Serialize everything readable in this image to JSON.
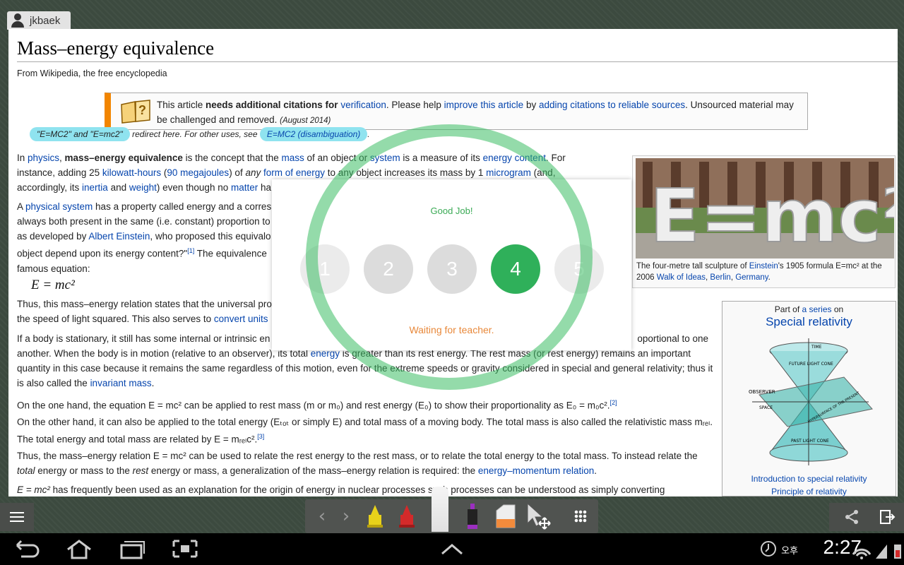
{
  "user": {
    "name": "jkbaek"
  },
  "article": {
    "title": "Mass–energy equivalence",
    "from_line": "From Wikipedia, the free encyclopedia",
    "citation": {
      "t1": "This article ",
      "t2": "needs additional citations for ",
      "t3": "verification",
      "t4": ". Please help ",
      "t5": "improve this article",
      "t6": " by ",
      "t7": "adding citations to reliable sources",
      "t8": ". Unsourced material may be challenged and removed. ",
      "date": "(August 2014)"
    },
    "hatnote": {
      "h1": "\"E=MC2\" and \"E=mc2\"",
      "h2": " redirect here. For other uses, see ",
      "h3": "E=MC2 (disambiguation)",
      "h4": "."
    },
    "p1": {
      "a": "In ",
      "physics": "physics",
      "b": ", ",
      "bold": "mass–energy equivalence",
      "c": " is the concept that the ",
      "mass": "mass",
      "d": " of an object or ",
      "system": "system",
      "e": " is a measure of its ",
      "energy_content": "energy content",
      "f": ". For instance, adding 25 ",
      "kwh": "kilowatt-hours",
      "g": " (",
      "mj": "90 megajoules",
      "h": ") of ",
      "any": "any",
      "i": " ",
      "form": "form of energy",
      "j": " to any object increases its mass by 1 ",
      "microgram": "microgram",
      "k": " (and, accordingly, its ",
      "inertia": "inertia",
      "l": " and ",
      "weight": "weight",
      "m": ") even though no ",
      "matter": "matter",
      "n": " ha"
    },
    "p2": {
      "a": "A ",
      "phys_sys": "physical system",
      "b": " has a property called energy and a corres",
      "c": "always both present in the same (i.e. constant) proportion to",
      "d": "as developed by ",
      "einstein": "Albert Einstein",
      "e": ", who proposed this equivalo",
      "f": "object depend upon its energy content?\"",
      "ref": "[1]",
      "g": " The equivalence",
      "h": "famous equation:"
    },
    "equation": "E = mc²",
    "p3": {
      "a": "Thus, this mass–energy relation states that the universal pro",
      "b": "the speed of light squared. This also serves to ",
      "convert": "convert units"
    },
    "p4": {
      "a": "If a body is stationary, it still has some internal or intrinsic en",
      "a2": "oportional to one another. When the body is in motion (relative to an observer), its total ",
      "energy": "energy",
      "b": " is greater than its rest energy. The rest mass (or rest energy) remains an important quantity in this case because it remains the same regardless of this motion, even for the extreme speeds or gravity considered in special and general relativity; thus it is also called the ",
      "invariant": "invariant mass",
      "c": "."
    },
    "p5": "On the one hand, the equation E = mc² can be applied to rest mass (m or m₀) and rest energy (E₀) to show their proportionality as E₀ = m₀c².",
    "p5_ref": "[2]",
    "p6": "On the other hand, it can also be applied to the total energy (Eₜₒₜ or simply E) and total mass of a moving body. The total mass is also called the relativistic mass mᵣₑₗ. The total energy and total mass are related by E = mᵣₑₗc².",
    "p6_ref": "[3]",
    "p7": {
      "a": "Thus, the mass–energy relation E = mc² can be used to relate the rest energy to the rest mass, or to relate the total energy to the total mass. To instead relate the ",
      "total": "total",
      "b": " energy or mass to the ",
      "rest": "rest",
      "c": " energy or mass, a generalization of the mass–energy relation is required: the ",
      "link": "energy–momentum relation",
      "d": "."
    },
    "p8": {
      "a": "E = mc²",
      "b": " has frequently been used as an explanation for the origin of energy in nuclear processes",
      "c": " such processes can be understood as simply converting"
    },
    "image_caption": {
      "a": "The four-metre tall sculpture of ",
      "einstein": "Einstein",
      "b": "'s 1905 formula E=mc² at the 2006 ",
      "walk": "Walk of Ideas",
      "c": ", ",
      "berlin": "Berlin",
      "d": ", ",
      "germany": "Germany",
      "e": "."
    },
    "image_text": "E=mc²",
    "sidebar": {
      "part_of_a": "Part of ",
      "part_of_link": "a series",
      "part_of_b": " on",
      "title": "Special relativity",
      "diagram": {
        "time": "TIME",
        "future": "FUTURE LIGHT CONE",
        "observer": "OBSERVER",
        "space": "SPACE",
        "hypersurface": "HYPERSURFACE OF THE PRESENT",
        "past": "PAST LIGHT CONE"
      },
      "link1": "Introduction to special relativity",
      "link2": "Principle of relativity"
    }
  },
  "quiz": {
    "feedback": "Good Job!",
    "options": [
      "1",
      "2",
      "3",
      "4",
      "5"
    ],
    "selected": "4",
    "status": "Waiting for teacher."
  },
  "toolbar": {
    "prev": "‹",
    "next": "›",
    "highlighter_colors": [
      "#e8d21a",
      "#d42a2a",
      "#9b2fc0"
    ],
    "accent": "#2fb05a"
  },
  "statusbar": {
    "ampm": "오후",
    "time": "2:27"
  }
}
